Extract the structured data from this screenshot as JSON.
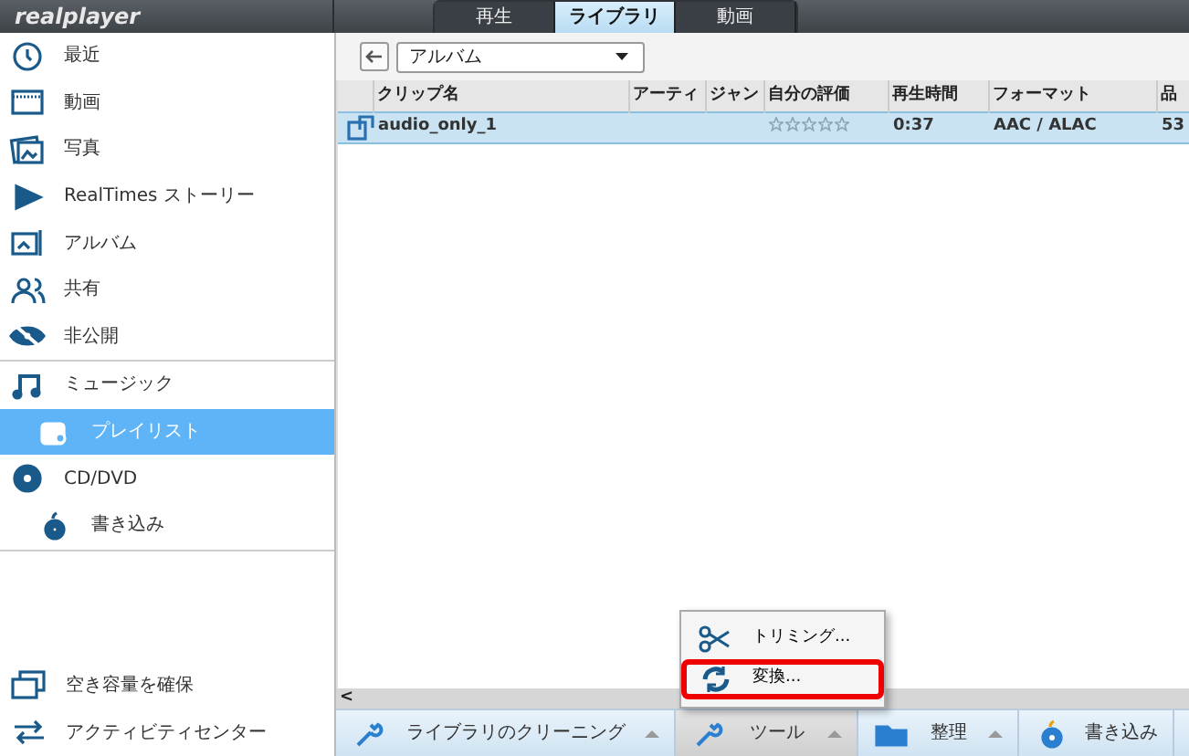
{
  "app": {
    "logo": "realplayer"
  },
  "tabs": [
    {
      "label": "再生",
      "selected": false
    },
    {
      "label": "ライブラリ",
      "selected": true
    },
    {
      "label": "動画",
      "selected": false
    }
  ],
  "sidebar": {
    "sections": [
      {
        "items": [
          {
            "label": "最近",
            "selected": false
          },
          {
            "label": "動画",
            "selected": false
          },
          {
            "label": "写真",
            "selected": false
          },
          {
            "label": "RealTimes ストーリー",
            "selected": false
          },
          {
            "label": "アルバム",
            "selected": false
          },
          {
            "label": "共有",
            "selected": false
          },
          {
            "label": "非公開",
            "selected": false
          }
        ]
      },
      {
        "items": [
          {
            "label": "ミュージック",
            "selected": false,
            "children": [
              {
                "label": "プレイリスト",
                "selected": true
              }
            ]
          },
          {
            "label": "CD/DVD",
            "selected": false,
            "children": [
              {
                "label": "書き込み",
                "selected": false
              }
            ]
          }
        ]
      }
    ],
    "footer_items": [
      {
        "label": "空き容量を確保"
      },
      {
        "label": "アクティビティセンター"
      }
    ]
  },
  "view_dropdown": {
    "value": "アルバム"
  },
  "table": {
    "columns": [
      "クリップ名",
      "アーティ",
      "ジャン",
      "自分の評価",
      "再生時間",
      "フォーマット",
      "品"
    ],
    "rows": [
      {
        "selected": true,
        "clip": "audio_only_1",
        "artist": "",
        "genre": "",
        "stars": 0,
        "duration": "0:37",
        "format": "AAC / ALAC",
        "quality": "53"
      }
    ]
  },
  "scrollbar": {
    "left_arrow": "<"
  },
  "tools_menu": {
    "items": [
      {
        "label": "トリミング...",
        "highlighted": false
      },
      {
        "label": "変換...",
        "highlighted": true
      }
    ]
  },
  "bottom_toolbar": [
    {
      "label": "ライブラリのクリーニング",
      "active": false,
      "has_menu": true
    },
    {
      "label": "ツール",
      "active": true,
      "has_menu": true
    },
    {
      "label": "整理",
      "active": false,
      "has_menu": true
    },
    {
      "label": "書き込み",
      "active": false,
      "has_menu": false
    }
  ]
}
